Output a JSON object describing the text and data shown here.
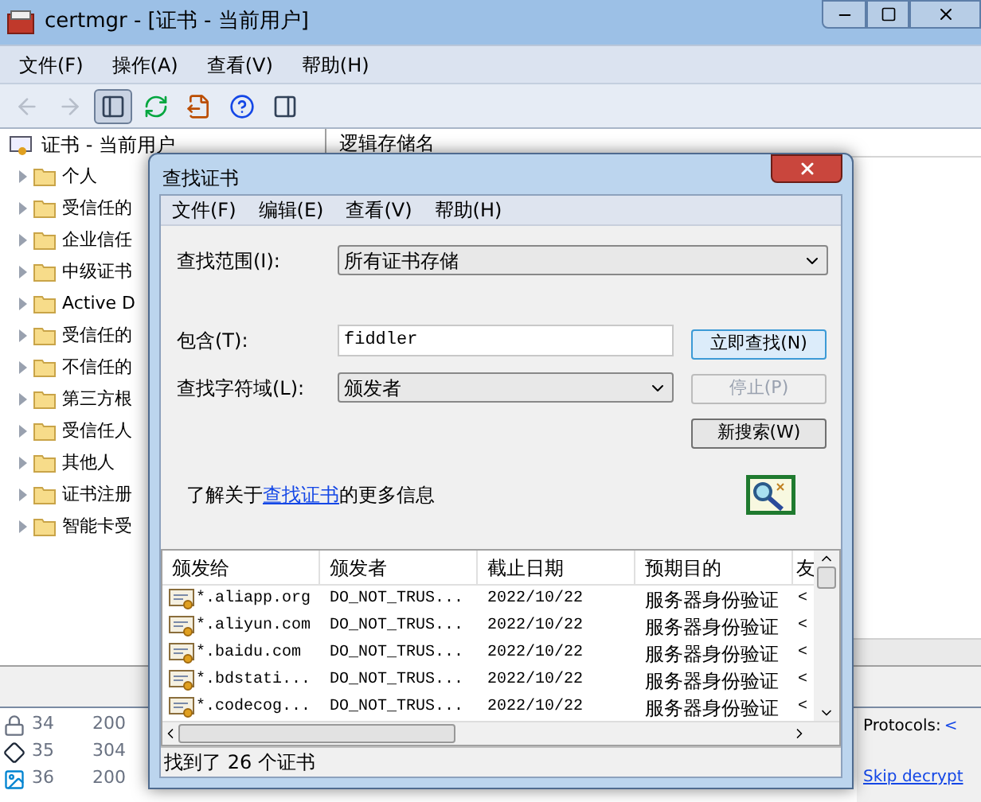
{
  "main_window": {
    "title": "certmgr - [证书 - 当前用户]",
    "menu": [
      "文件(F)",
      "操作(A)",
      "查看(V)",
      "帮助(H)"
    ],
    "toolbar": [
      {
        "kind": "back",
        "disabled": true,
        "pressed": false
      },
      {
        "kind": "forward",
        "disabled": true,
        "pressed": false
      },
      {
        "kind": "tree",
        "disabled": false,
        "pressed": true
      },
      {
        "kind": "refresh",
        "disabled": false,
        "pressed": false
      },
      {
        "kind": "export",
        "disabled": false,
        "pressed": false
      },
      {
        "kind": "help",
        "disabled": false,
        "pressed": false
      },
      {
        "kind": "action_pane",
        "disabled": false,
        "pressed": false
      }
    ],
    "tree": {
      "root": "证书 - 当前用户",
      "items": [
        {
          "label": "个人",
          "expanded": false
        },
        {
          "label": "受信任的",
          "expanded": false
        },
        {
          "label": "企业信任",
          "expanded": false
        },
        {
          "label": "中级证书",
          "expanded": false
        },
        {
          "label": "Active D",
          "expanded": false
        },
        {
          "label": "受信任的",
          "expanded": false
        },
        {
          "label": "不信任的",
          "expanded": false
        },
        {
          "label": "第三方根",
          "expanded": false
        },
        {
          "label": "受信任人",
          "expanded": false
        },
        {
          "label": "其他人",
          "expanded": false
        },
        {
          "label": "证书注册",
          "expanded": false
        },
        {
          "label": "智能卡受",
          "expanded": false
        }
      ]
    },
    "right_pane": {
      "column_1": "逻辑存储名"
    }
  },
  "dialog": {
    "title": "查找证书",
    "menu": [
      "文件(F)",
      "编辑(E)",
      "查看(V)",
      "帮助(H)"
    ],
    "scope_label": "查找范围(I):",
    "scope_value": "所有证书存储",
    "contains_label": "包含(T):",
    "contains_value": "fiddler",
    "field_label": "查找字符域(L):",
    "field_value": "颁发者",
    "buttons": [
      {
        "label": "立即查找(N)",
        "disabled": false,
        "default": true
      },
      {
        "label": "停止(P)",
        "disabled": true,
        "default": false
      },
      {
        "label": "新搜索(W)",
        "disabled": false,
        "default": false
      }
    ],
    "help_prefix": "了解关于",
    "help_link": "查找证书",
    "help_suffix": "的更多信息",
    "table": {
      "columns": [
        "颁发给",
        "颁发者",
        "截止日期",
        "预期目的",
        "友"
      ],
      "rows": [
        {
          "cells": [
            "*.aliapp.org",
            "DO_NOT_TRUS...",
            "2022/10/22",
            "服务器身份验证",
            "<"
          ]
        },
        {
          "cells": [
            "*.aliyun.com",
            "DO_NOT_TRUS...",
            "2022/10/22",
            "服务器身份验证",
            "<"
          ]
        },
        {
          "cells": [
            "*.baidu.com",
            "DO_NOT_TRUS...",
            "2022/10/22",
            "服务器身份验证",
            "<"
          ]
        },
        {
          "cells": [
            "*.bdstati...",
            "DO_NOT_TRUS...",
            "2022/10/22",
            "服务器身份验证",
            "<"
          ]
        },
        {
          "cells": [
            "*.codecog...",
            "DO_NOT_TRUS...",
            "2022/10/22",
            "服务器身份验证",
            "<"
          ]
        }
      ]
    },
    "status": "找到了 26 个证书"
  },
  "background_window": {
    "sessions": [
      {
        "number": "34",
        "result": "200",
        "kind": "lock"
      },
      {
        "number": "35",
        "result": "304",
        "kind": "diamond"
      },
      {
        "number": "36",
        "result": "200",
        "kind": "image"
      }
    ],
    "protocols_label": "Protocols:",
    "protocols_value": "<",
    "skip_link": "Skip decrypt"
  }
}
